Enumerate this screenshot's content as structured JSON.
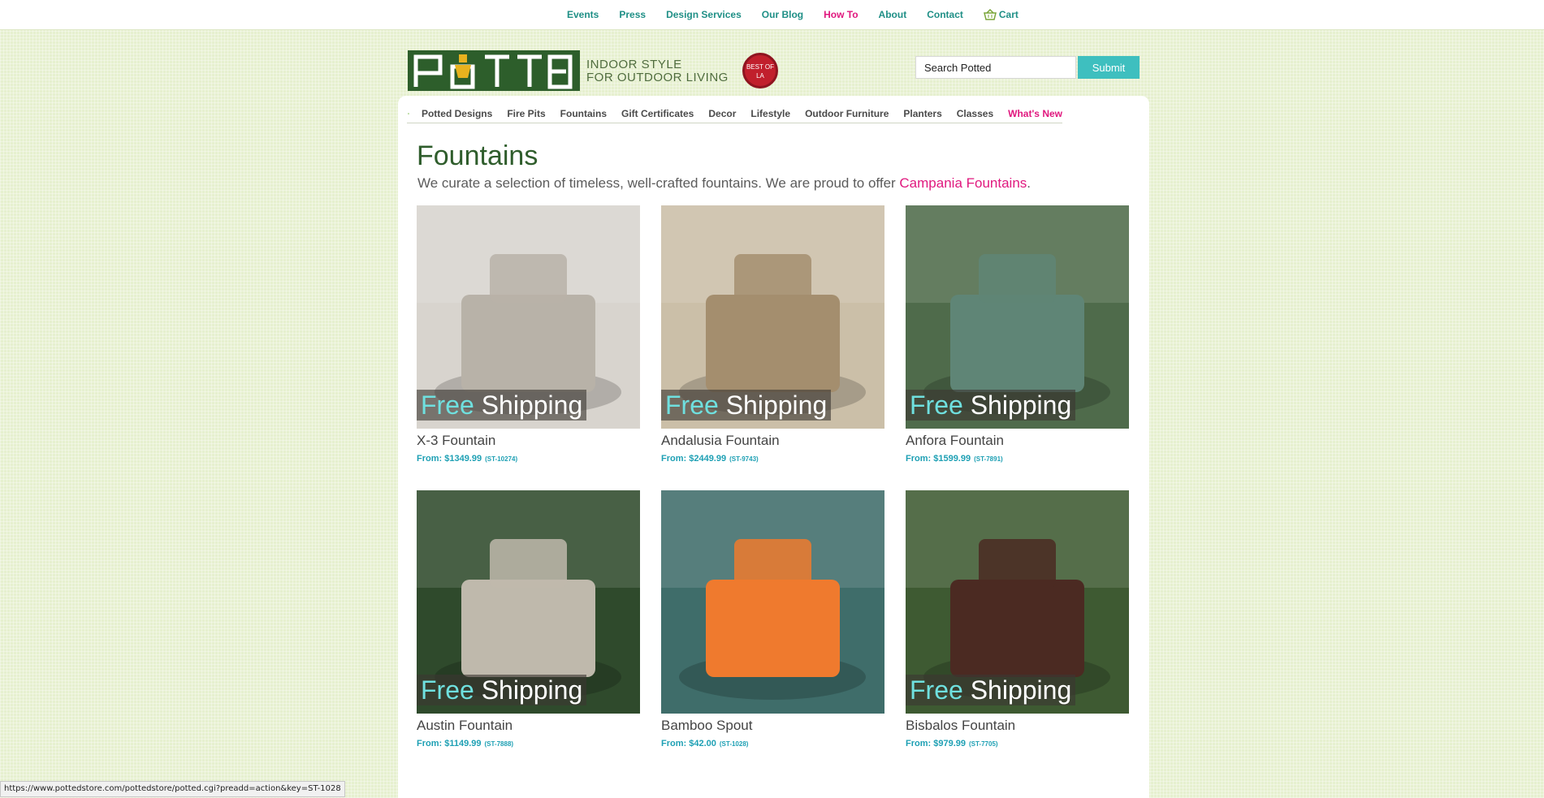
{
  "top_nav": [
    {
      "label": "Events",
      "highlight": false
    },
    {
      "label": "Press",
      "highlight": false
    },
    {
      "label": "Design Services",
      "highlight": false
    },
    {
      "label": "Our Blog",
      "highlight": false
    },
    {
      "label": "How To",
      "highlight": true
    },
    {
      "label": "About",
      "highlight": false
    },
    {
      "label": "Contact",
      "highlight": false
    }
  ],
  "cart_label": "Cart",
  "logo": {
    "text": "POTTED",
    "tagline_line1": "INDOOR STYLE",
    "tagline_line2": "FOR OUTDOOR LIVING",
    "badge": "BEST OF LA"
  },
  "search": {
    "value": "Search Potted",
    "button": "Submit"
  },
  "category_nav": [
    "Potted Designs",
    "Fire Pits",
    "Fountains",
    "Gift Certificates",
    "Decor",
    "Lifestyle",
    "Outdoor Furniture",
    "Planters",
    "Classes"
  ],
  "category_nav_highlight": "What's New",
  "page": {
    "title": "Fountains",
    "intro_text": "We curate a selection of timeless, well-crafted fountains. We are proud to offer ",
    "intro_link": "Campania Fountains",
    "intro_end": "."
  },
  "ribbon": {
    "free": "Free",
    "shipping": "Shipping"
  },
  "products": [
    {
      "name": "X-3 Fountain",
      "price": "From: $1349.99",
      "sku": "(ST-10274)",
      "ribbon": true,
      "bg": "#d8d4ce",
      "accent": "#b8b2a8"
    },
    {
      "name": "Andalusia Fountain",
      "price": "From: $2449.99",
      "sku": "(ST-9743)",
      "ribbon": true,
      "bg": "#cbbfa8",
      "accent": "#a48e6e"
    },
    {
      "name": "Anfora Fountain",
      "price": "From: $1599.99",
      "sku": "(ST-7891)",
      "ribbon": true,
      "bg": "#4f6b4b",
      "accent": "#5f8576"
    },
    {
      "name": "Austin Fountain",
      "price": "From: $1149.99",
      "sku": "(ST-7888)",
      "ribbon": true,
      "bg": "#2f4a2c",
      "accent": "#bfb9ac"
    },
    {
      "name": "Bamboo Spout",
      "price": "From: $42.00",
      "sku": "(ST-1028)",
      "ribbon": false,
      "bg": "#3f6d6a",
      "accent": "#ef7a2e"
    },
    {
      "name": "Bisbalos Fountain",
      "price": "From: $979.99",
      "sku": "(ST-7705)",
      "ribbon": true,
      "bg": "#3e5a32",
      "accent": "#4b2a22"
    }
  ],
  "status_bar": "https://www.pottedstore.com/pottedstore/potted.cgi?preadd=action&key=ST-1028",
  "colors": {
    "brand_green": "#2d5e2b",
    "teal": "#1f8f86",
    "pink": "#e0187e",
    "button": "#3ebfbf"
  }
}
